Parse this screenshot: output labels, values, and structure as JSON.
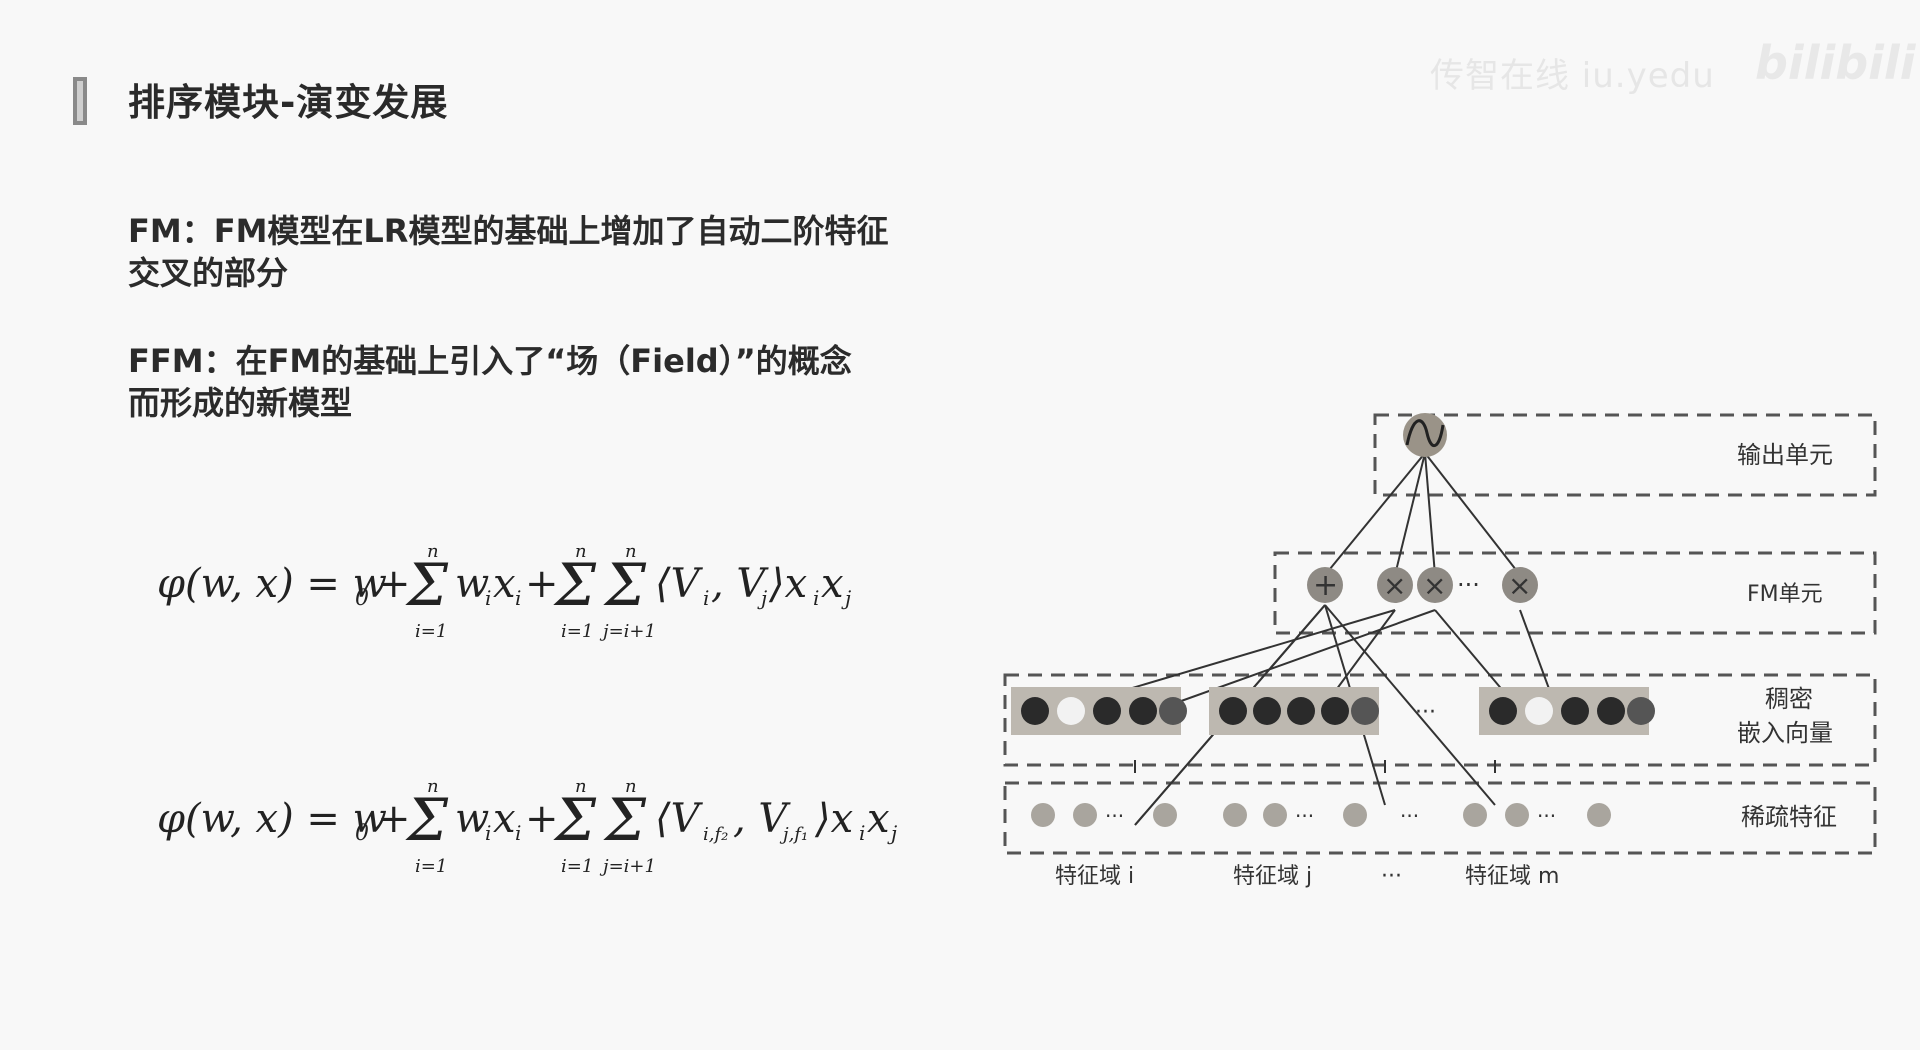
{
  "header": {
    "title": "排序模块-演变发展",
    "watermark": "传智在线 iu.yedu",
    "logo": "bilibili"
  },
  "paragraphs": {
    "fm_line1": "FM：FM模型在LR模型的基础上增加了自动二阶特征",
    "fm_line2": "交叉的部分",
    "ffm_line1": "FFM：在FM的基础上引入了“场（Field）”的概念",
    "ffm_line2": "而形成的新模型"
  },
  "formulas": {
    "fm": "φ(w, x) = w0 + Σ_{i=1}^{n} wi xi + Σ_{i=1}^{n} Σ_{j=i+1}^{n} ⟨Vi, Vj⟩ xi xj",
    "ffm": "φ(w, x) = w0 + Σ_{i=1}^{n} wi xi + Σ_{i=1}^{n} Σ_{j=i+1}^{n} ⟨Vi,f2, Vj,f1⟩ xi xj"
  },
  "diagram": {
    "layer_output": "输出单元",
    "layer_fm": "FM单元",
    "layer_dense_1": "稠密",
    "layer_dense_2": "嵌入向量",
    "layer_sparse": "稀疏特征",
    "field_i": "特征域 i",
    "field_j": "特征域 j",
    "field_dots": "···",
    "field_m": "特征域 m"
  }
}
